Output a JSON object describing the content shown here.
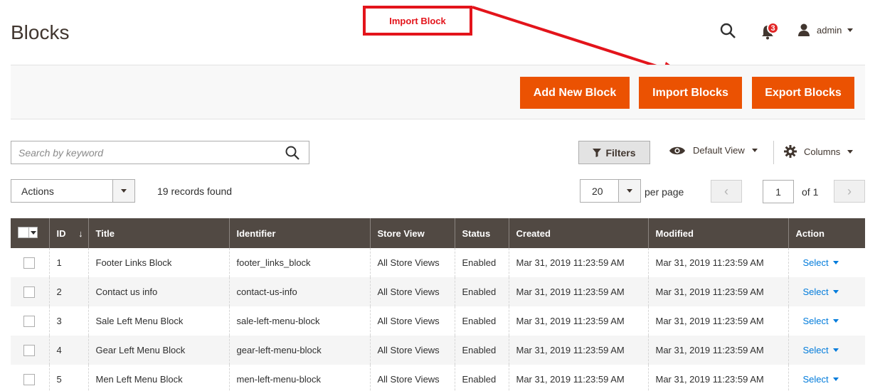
{
  "page": {
    "title": "Blocks"
  },
  "annotation": {
    "label": "Import Block"
  },
  "header": {
    "notifications_count": "3",
    "user_name": "admin",
    "icons": [
      "search-icon",
      "bell-icon",
      "user-icon"
    ]
  },
  "action_bar": {
    "add_label": "Add New Block",
    "import_label": "Import Blocks",
    "export_label": "Export Blocks",
    "accent_color": "#eb5202"
  },
  "toolbar": {
    "search_placeholder": "Search by keyword",
    "filters_label": "Filters",
    "view_label": "Default View",
    "columns_label": "Columns",
    "actions_label": "Actions",
    "records_text": "19 records found",
    "per_page_value": "20",
    "per_page_label": "per page",
    "page_current": "1",
    "page_total_text": "of 1"
  },
  "table": {
    "headers": [
      "ID",
      "Title",
      "Identifier",
      "Store View",
      "Status",
      "Created",
      "Modified",
      "Action"
    ],
    "sort_indicator": "↓",
    "rows": [
      {
        "id": "1",
        "title": "Footer Links Block",
        "identifier": "footer_links_block",
        "store": "All Store Views",
        "status": "Enabled",
        "created": "Mar 31, 2019 11:23:59 AM",
        "modified": "Mar 31, 2019 11:23:59 AM",
        "action": "Select"
      },
      {
        "id": "2",
        "title": "Contact us info",
        "identifier": "contact-us-info",
        "store": "All Store Views",
        "status": "Enabled",
        "created": "Mar 31, 2019 11:23:59 AM",
        "modified": "Mar 31, 2019 11:23:59 AM",
        "action": "Select"
      },
      {
        "id": "3",
        "title": "Sale Left Menu Block",
        "identifier": "sale-left-menu-block",
        "store": "All Store Views",
        "status": "Enabled",
        "created": "Mar 31, 2019 11:23:59 AM",
        "modified": "Mar 31, 2019 11:23:59 AM",
        "action": "Select"
      },
      {
        "id": "4",
        "title": "Gear Left Menu Block",
        "identifier": "gear-left-menu-block",
        "store": "All Store Views",
        "status": "Enabled",
        "created": "Mar 31, 2019 11:23:59 AM",
        "modified": "Mar 31, 2019 11:23:59 AM",
        "action": "Select"
      },
      {
        "id": "5",
        "title": "Men Left Menu Block",
        "identifier": "men-left-menu-block",
        "store": "All Store Views",
        "status": "Enabled",
        "created": "Mar 31, 2019 11:23:59 AM",
        "modified": "Mar 31, 2019 11:23:59 AM",
        "action": "Select"
      }
    ]
  }
}
